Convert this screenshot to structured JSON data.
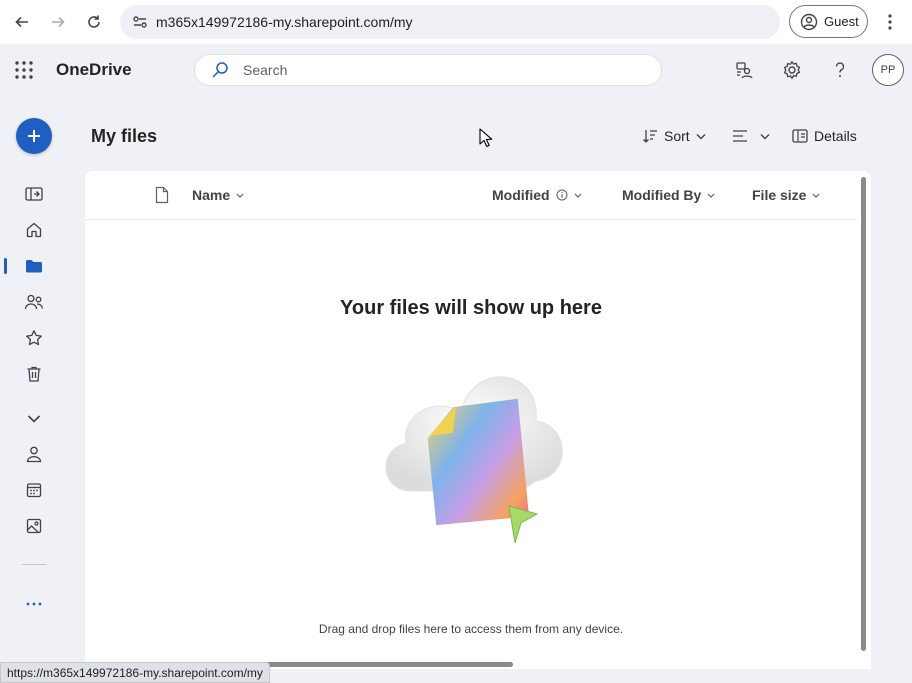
{
  "browser": {
    "url": "m365x149972186-my.sharepoint.com/my",
    "profile_label": "Guest",
    "status_url": "https://m365x149972186-my.sharepoint.com/my"
  },
  "app": {
    "name": "OneDrive",
    "search_placeholder": "Search",
    "avatar_initials": "PP",
    "accent_color": "#1f5fbf"
  },
  "page": {
    "title": "My files",
    "commands": {
      "sort_label": "Sort",
      "details_label": "Details"
    }
  },
  "table": {
    "columns": [
      "Name",
      "Modified",
      "Modified By",
      "File size"
    ]
  },
  "empty_state": {
    "title": "Your files will show up here",
    "subtitle": "Drag and drop files here to access them from any device."
  },
  "icons": {
    "rail": [
      "expand-pane-icon",
      "home-icon",
      "my-files-icon",
      "shared-icon",
      "favorites-icon",
      "recycle-bin-icon",
      "chevron-down-icon",
      "people-icon",
      "meetings-icon",
      "photos-icon",
      "more-icon"
    ]
  }
}
